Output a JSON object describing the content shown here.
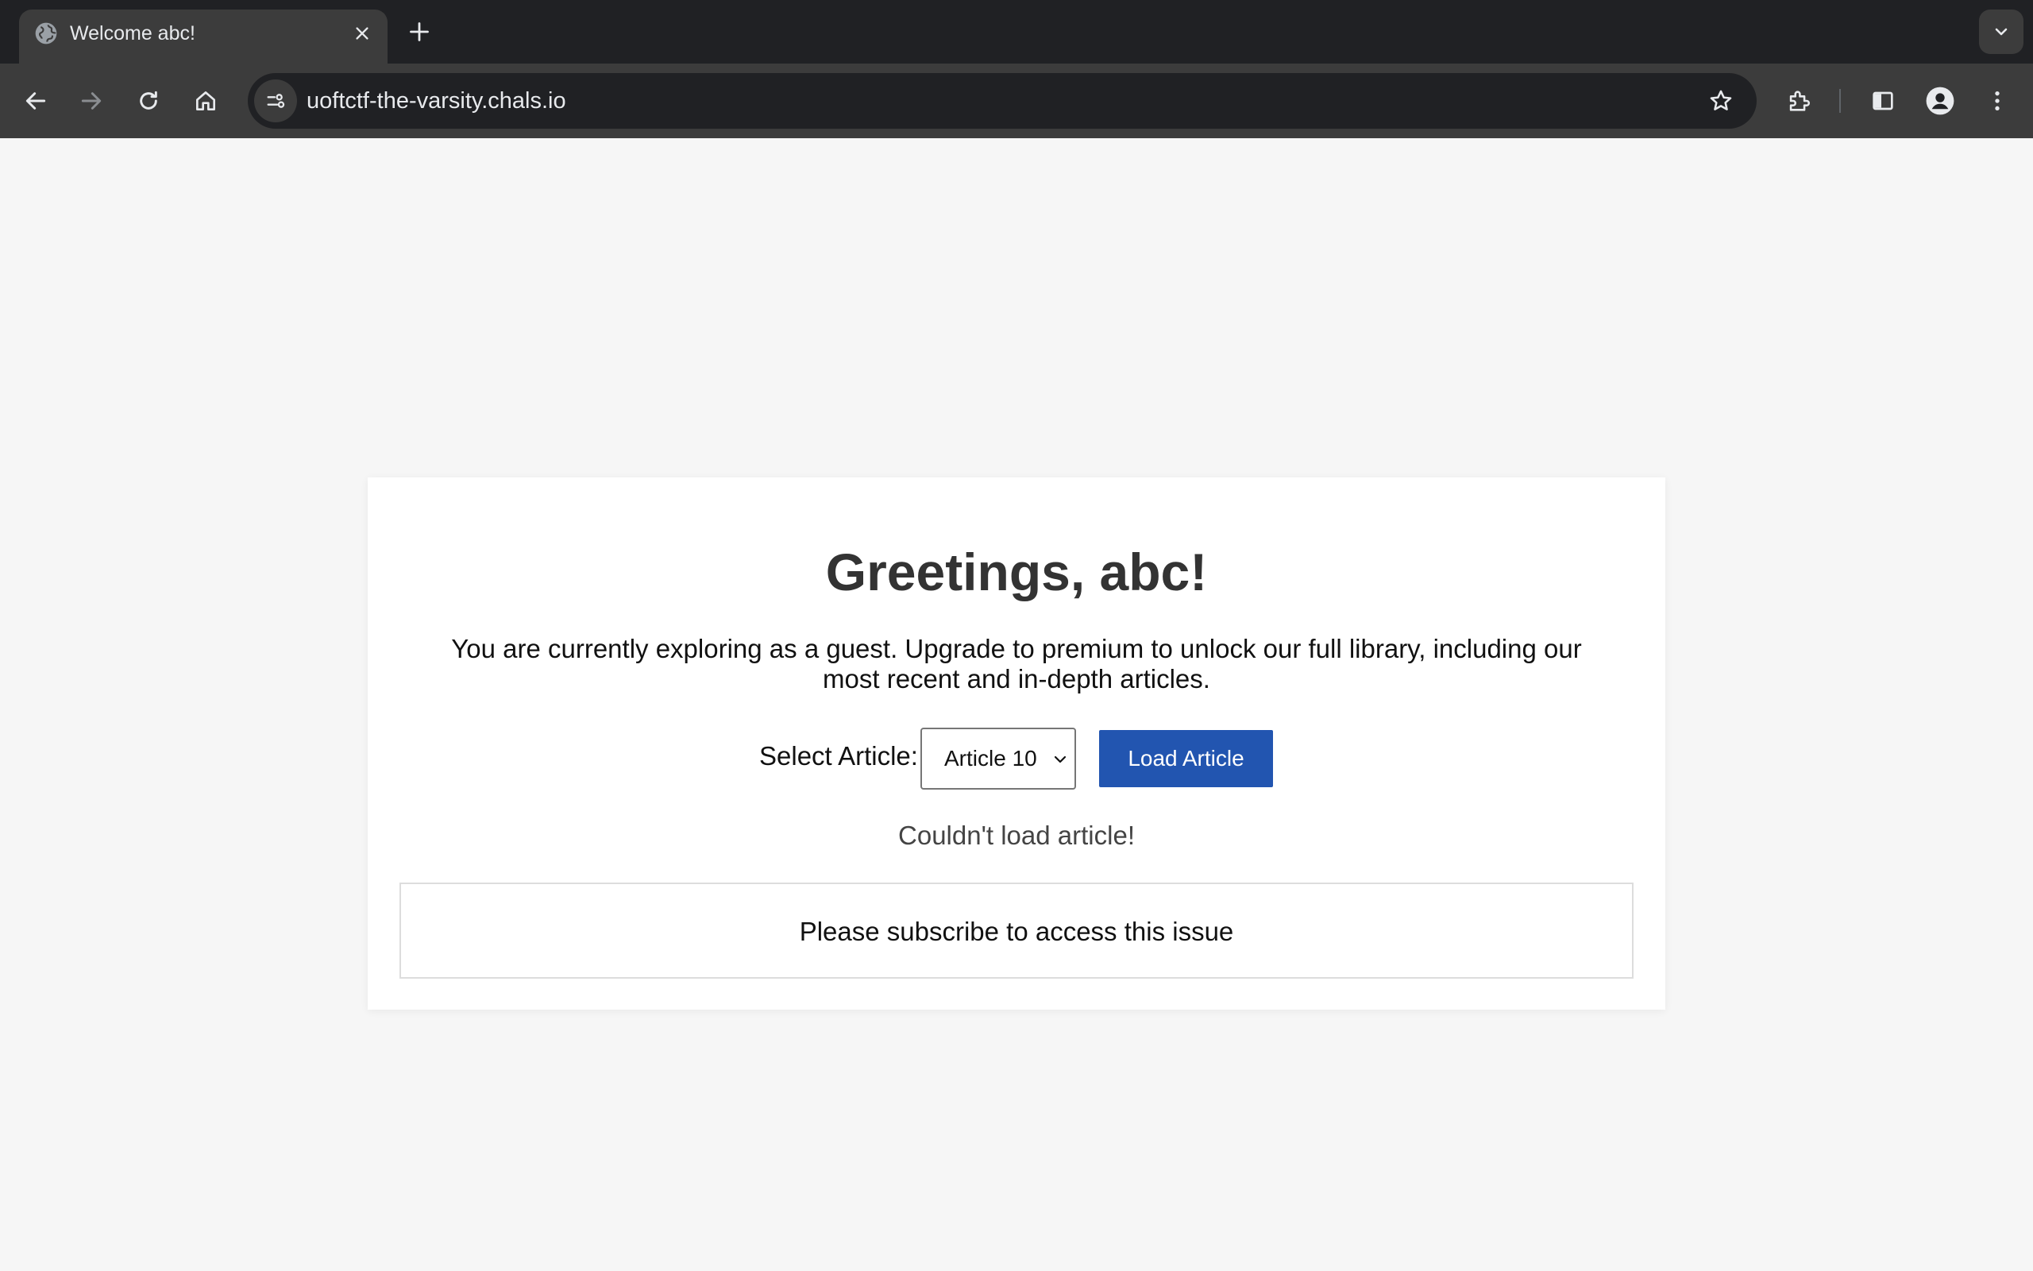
{
  "browser": {
    "tab": {
      "title": "Welcome abc!",
      "favicon": "globe-icon"
    },
    "new_tab_icon": "plus-icon",
    "tab_search_icon": "chevron-down-icon",
    "nav": {
      "back_icon": "back-arrow-icon",
      "forward_icon": "forward-arrow-icon",
      "reload_icon": "reload-icon",
      "home_icon": "home-icon"
    },
    "address_bar": {
      "url": "uoftctf-the-varsity.chals.io",
      "site_info_icon": "tune-icon",
      "bookmark_icon": "star-icon"
    },
    "toolbar_icons": [
      "extensions-icon",
      "side-panel-icon",
      "profile-icon",
      "menu-icon"
    ]
  },
  "page": {
    "heading": "Greetings, abc!",
    "intro": "You are currently exploring as a guest. Upgrade to premium to unlock our full library, including our most recent and in-depth articles.",
    "select_label": "Select Article:",
    "select_value": "Article 10",
    "load_button": "Load Article",
    "status": "Couldn't load article!",
    "article_content": "Please subscribe to access this issue",
    "colors": {
      "background": "#f6f6f6",
      "card": "#ffffff",
      "button": "#2255b0",
      "heading": "#333333"
    }
  }
}
